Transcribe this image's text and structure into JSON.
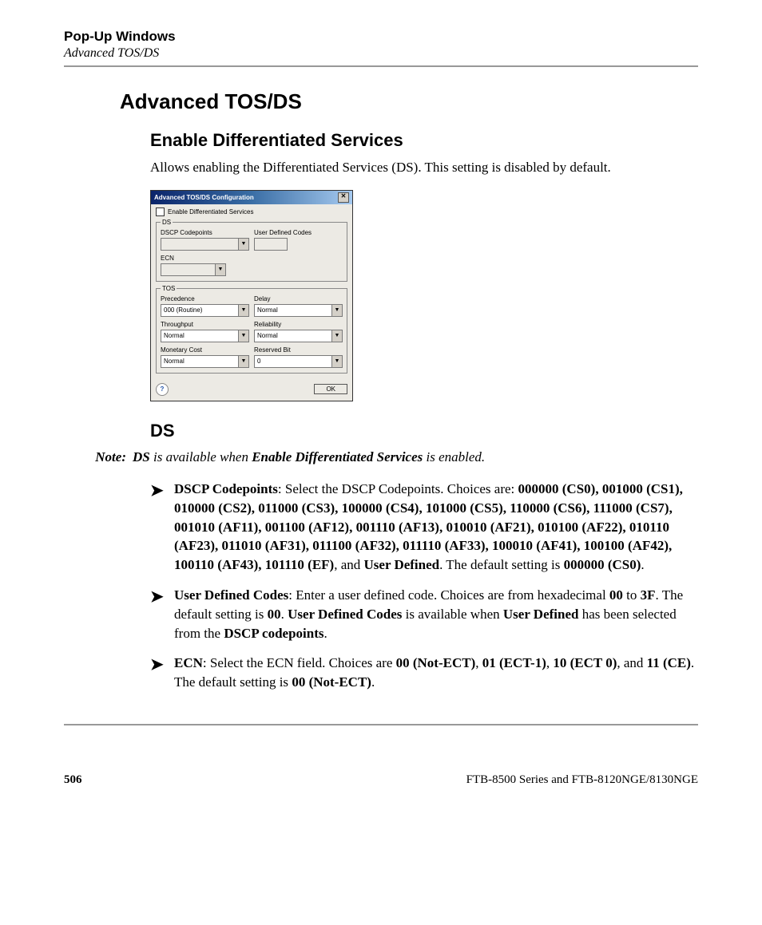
{
  "header": {
    "chapter": "Pop-Up Windows",
    "subchapter": "Advanced TOS/DS"
  },
  "page": {
    "title": "Advanced TOS/DS",
    "section1": {
      "heading": "Enable Differentiated Services",
      "body": "Allows enabling the Differentiated Services (DS). This setting is disabled by default."
    },
    "section2": {
      "heading": "DS"
    }
  },
  "dialog": {
    "title": "Advanced TOS/DS Configuration",
    "enable_label": "Enable Differentiated Services",
    "ds": {
      "legend": "DS",
      "dscp_label": "DSCP Codepoints",
      "dscp_value": "",
      "udc_label": "User Defined Codes",
      "udc_value": "",
      "ecn_label": "ECN",
      "ecn_value": ""
    },
    "tos": {
      "legend": "TOS",
      "precedence_label": "Precedence",
      "precedence_value": "000 (Routine)",
      "delay_label": "Delay",
      "delay_value": "Normal",
      "throughput_label": "Throughput",
      "throughput_value": "Normal",
      "reliability_label": "Reliability",
      "reliability_value": "Normal",
      "monetary_label": "Monetary Cost",
      "monetary_value": "Normal",
      "reserved_label": "Reserved Bit",
      "reserved_value": "0"
    },
    "help": "?",
    "ok": "OK"
  },
  "note": {
    "label": "Note:",
    "pre": "DS",
    "mid": " is available when ",
    "bold": "Enable Differentiated Services",
    "post": " is enabled."
  },
  "bullets": {
    "b1": {
      "lead": "DSCP Codepoints",
      "after_lead": ": Select the DSCP Codepoints. Choices are: ",
      "codes": "000000 (CS0), 001000 (CS1), 010000 (CS2), 011000 (CS3), 100000 (CS4), 101000 (CS5), 110000 (CS6), 111000 (CS7), 001010 (AF11), 001100 (AF12), 001110 (AF13), 010010 (AF21), 010100 (AF22), 010110 (AF23), 011010 (AF31), 011100 (AF32), 011110 (AF33), 100010 (AF41), 100100 (AF42), 100110 (AF43), 101110 (EF)",
      "and": ", and ",
      "ud": "User Defined",
      "tail1": ". The default setting is ",
      "def": "000000 (CS0)",
      "tail2": "."
    },
    "b2": {
      "lead": "User Defined Codes",
      "after_lead": ": Enter a user defined code. Choices are from hexadecimal ",
      "c00": "00",
      "to": " to ",
      "c3f": "3F",
      "d1": ". The default setting is ",
      "d00": "00",
      "d2": ". ",
      "udc": "User Defined Codes",
      "d3": " is available when ",
      "ud": "User Defined",
      "d4": " has been selected from the ",
      "dscp": "DSCP codepoints",
      "d5": "."
    },
    "b3": {
      "lead": "ECN",
      "after_lead": ": Select the ECN field. Choices are ",
      "c1": "00 (Not-ECT)",
      "s1": ", ",
      "c2": "01 (ECT-1)",
      "s2": ", ",
      "c3": "10 (ECT 0)",
      "s3": ", and ",
      "c4": "11 (CE)",
      "tail1": ". The default setting is ",
      "def": "00 (Not-ECT)",
      "tail2": "."
    }
  },
  "footer": {
    "page_number": "506",
    "product": "FTB-8500 Series and FTB-8120NGE/8130NGE"
  }
}
